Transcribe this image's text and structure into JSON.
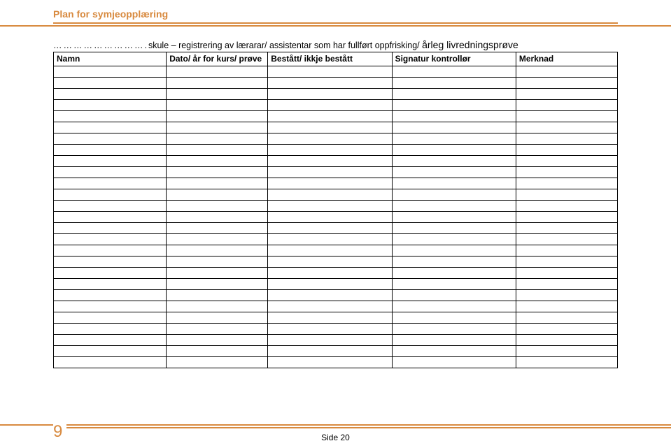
{
  "header": {
    "title": "Plan for symjeopplæring"
  },
  "intro": {
    "dots": "……………………….",
    "text_regular": "skule – registrering av lærarar/ assistentar som har fullført oppfrisking/ ",
    "text_large": "årleg livredningsprøve"
  },
  "table": {
    "headers": {
      "namn": "Namn",
      "dato": "Dato/ år for kurs/ prøve",
      "bestatt": "Bestått/ ikkje bestått",
      "signatur": "Signatur kontrollør",
      "merknad": "Merknad"
    },
    "row_count": 27
  },
  "footer": {
    "page_number": "9",
    "side_label": "Side 20"
  }
}
